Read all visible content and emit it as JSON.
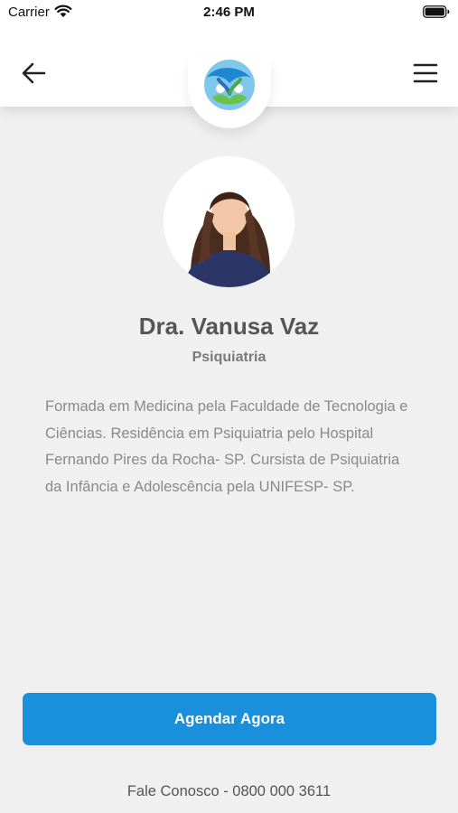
{
  "status_bar": {
    "carrier": "Carrier",
    "time": "2:46 PM"
  },
  "nav": {
    "back_icon": "arrow-left-icon",
    "menu_icon": "hamburger-menu-icon",
    "logo": "globe-people-logo"
  },
  "doctor": {
    "name": "Dra. Vanusa Vaz",
    "specialty": "Psiquiatria",
    "bio": "Formada em Medicina pela Faculdade de Tecnologia e Ciências. Residência em Psiquiatria pelo Hospital Fernando Pires da Rocha- SP. Cursista de Psiquiatria da Infância e Adolescência pela UNIFESP- SP."
  },
  "cta": {
    "label": "Agendar Agora"
  },
  "footer": {
    "contact": "Fale Conosco - 0800 000 3611"
  },
  "colors": {
    "accent": "#1a90dd",
    "background": "#f0f0f0",
    "text_muted": "#8a8a8a"
  }
}
